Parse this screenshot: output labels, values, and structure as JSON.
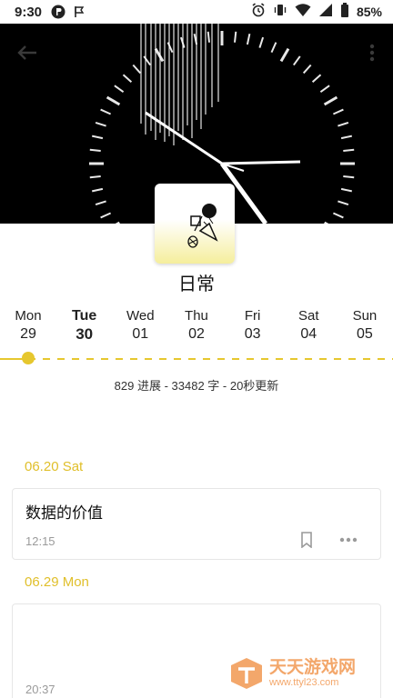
{
  "status_bar": {
    "time": "9:30",
    "battery": "85%"
  },
  "notebook": {
    "title": "日常"
  },
  "week": [
    {
      "name": "Mon",
      "num": "29"
    },
    {
      "name": "Tue",
      "num": "30"
    },
    {
      "name": "Wed",
      "num": "01"
    },
    {
      "name": "Thu",
      "num": "02"
    },
    {
      "name": "Fri",
      "num": "03"
    },
    {
      "name": "Sat",
      "num": "04"
    },
    {
      "name": "Sun",
      "num": "05"
    }
  ],
  "selected_day": "Tue",
  "stats": "829 进展 - 33482 字 - 20秒更新",
  "entries": [
    {
      "date": "06.20 Sat",
      "title": "数据的价值",
      "time": "12:15"
    },
    {
      "date": "06.29 Mon",
      "title": "",
      "time": "20:37"
    }
  ],
  "watermark": {
    "title": "天天游戏网",
    "url": "www.ttyl23.com"
  },
  "colors": {
    "accent": "#e6c72e",
    "date_text": "#e0bf2a",
    "hero_bg": "#000000"
  }
}
